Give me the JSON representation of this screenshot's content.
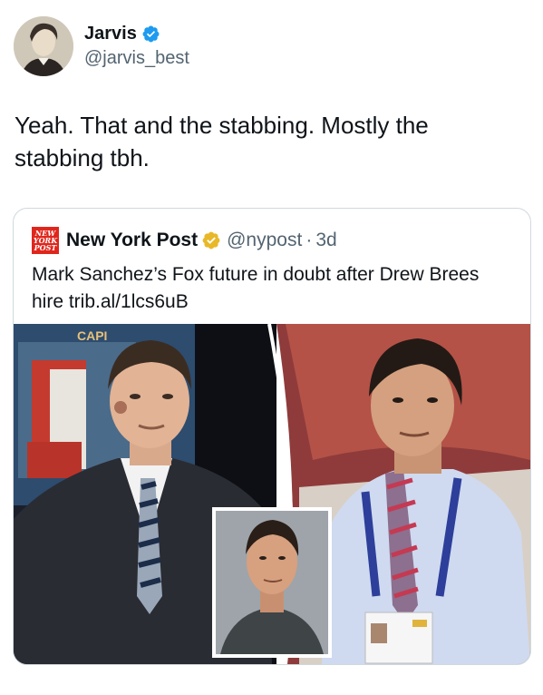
{
  "author": {
    "name": "Jarvis",
    "handle": "@jarvis_best"
  },
  "tweet": {
    "text": "Yeah.  That and the stabbing.  Mostly the stabbing tbh."
  },
  "quoted": {
    "logo_text": [
      "NEW",
      "YORK",
      "POST"
    ],
    "name": "New York Post",
    "handle": "@nypost",
    "separator": "·",
    "age": "3d",
    "text": "Mark Sanchez’s Fox future in doubt after Drew Brees hire trib.al/1lcs6uB",
    "screen_text": "CAPI"
  },
  "colors": {
    "verified_blue": "#1d9bf0",
    "verified_gold": "#e8b829",
    "nyp_red": "#e0261c"
  }
}
